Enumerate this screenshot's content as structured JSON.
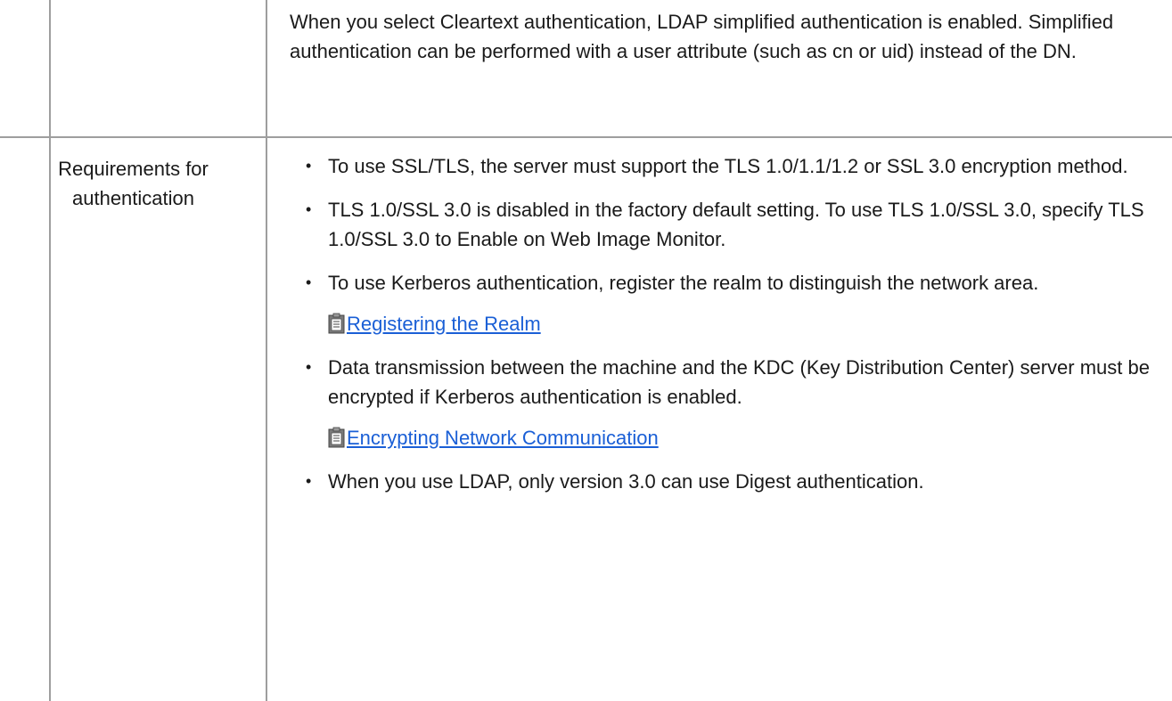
{
  "row1": {
    "description": "When you select Cleartext authentication, LDAP simplified authentication is enabled. Simplified authentication can be performed with a user attribute (such as cn or uid) instead of the DN."
  },
  "row2": {
    "label": "Requirements for authentication",
    "bullets": [
      {
        "text": "To use SSL/TLS, the server must support the TLS 1.0/1.1/1.2 or SSL 3.0 encryption method."
      },
      {
        "text": "TLS 1.0/SSL 3.0 is disabled in the factory default setting. To use TLS 1.0/SSL 3.0, specify TLS 1.0/SSL 3.0 to Enable on Web Image Monitor."
      },
      {
        "text": "To use Kerberos authentication, register the realm to distinguish the network area.",
        "link": "Registering the Realm"
      },
      {
        "text": "Data transmission between the machine and the KDC (Key Distribution Center) server must be encrypted if Kerberos authentication is enabled.",
        "link": "Encrypting Network Communication"
      },
      {
        "text": "When you use LDAP, only version 3.0 can use Digest authentication."
      }
    ]
  },
  "colors": {
    "border": "#9e9e9e",
    "link": "#1a5fd6",
    "text": "#1a1a1a"
  },
  "icons": {
    "link_icon": "document-note-icon"
  }
}
